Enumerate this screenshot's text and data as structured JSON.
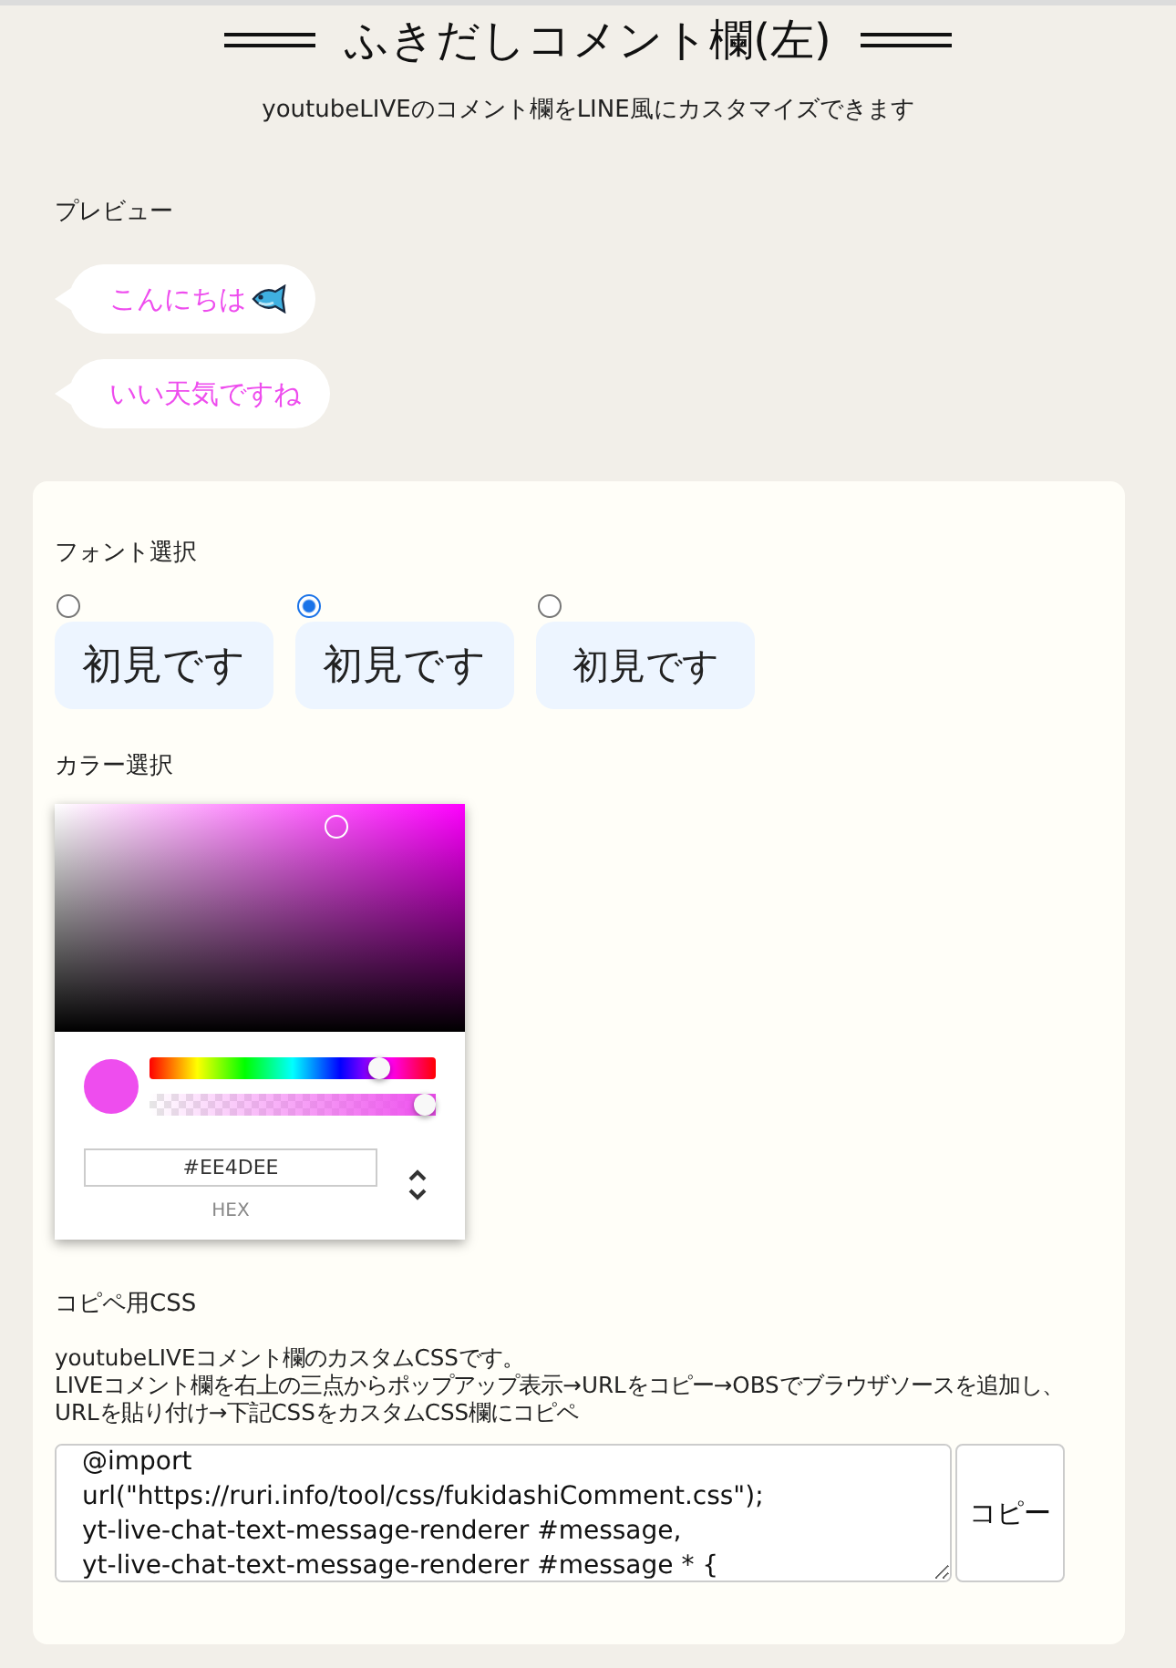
{
  "header": {
    "title": "ふきだしコメント欄(左)",
    "subtitle": "youtubeLIVEのコメント欄をLINE風にカスタマイズできます"
  },
  "preview": {
    "label": "プレビュー",
    "bubbles": [
      {
        "text": "こんにちは",
        "kind": "with_icon"
      },
      {
        "text": "いい天気ですね",
        "kind": "plain"
      }
    ]
  },
  "font_select": {
    "label": "フォント選択",
    "options": [
      {
        "text": "初見です",
        "kind": "gothic",
        "selected": false
      },
      {
        "text": "初見です",
        "kind": "round",
        "selected": true
      },
      {
        "text": "初見です",
        "kind": "mono",
        "selected": false
      }
    ]
  },
  "color_select": {
    "label": "カラー選択",
    "color": "#ee4dee",
    "hue": {
      "level": 0.83
    },
    "alpha": {
      "level": 1
    },
    "hex": "#EE4DEE",
    "format": "HEX"
  },
  "css_copy": {
    "label": "コピペ用CSS",
    "description": [
      "youtubeLIVEコメント欄のカスタムCSSです。",
      "LIVEコメント欄を右上の三点からポップアップ表示→URLをコピー→OBSでブラウザソースを追加し、URLを貼り付け→下記CSSをカスタムCSS欄にコピペ"
    ],
    "code": "@import url(\"https://ruri.info/tool/css/fukidashiComment.css\");\nyt-live-chat-text-message-renderer #message,\nyt-live-chat-text-message-renderer #message * {",
    "button": "コピー"
  }
}
